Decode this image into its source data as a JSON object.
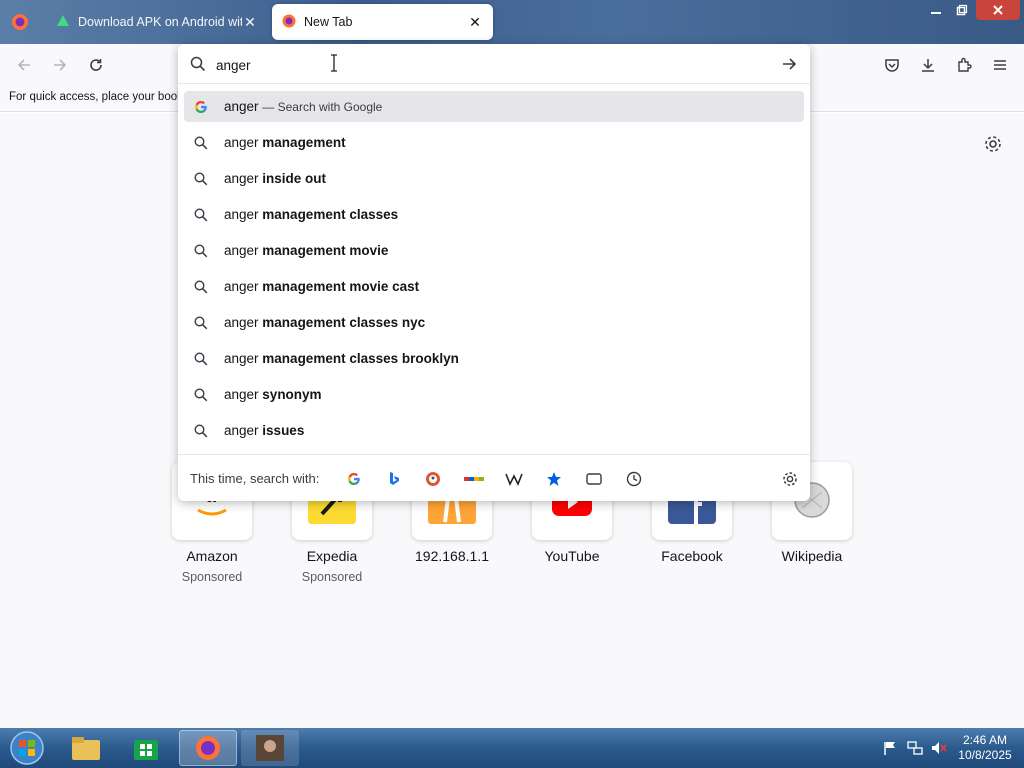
{
  "browser": {
    "tabs": [
      {
        "title": "Download APK on Android with Fre",
        "active": false
      },
      {
        "title": "New Tab",
        "active": true
      }
    ],
    "urlbar": {
      "value": "anger"
    },
    "bookmarks_hint": "For quick access, place your bookm"
  },
  "suggestions": [
    {
      "prefix": "anger",
      "suffix": "",
      "sub": "— Search with Google",
      "icon": "google-icon"
    },
    {
      "prefix": "anger",
      "suffix": "management",
      "icon": "search-icon"
    },
    {
      "prefix": "anger",
      "suffix": "inside out",
      "icon": "search-icon"
    },
    {
      "prefix": "anger",
      "suffix": "management classes",
      "icon": "search-icon"
    },
    {
      "prefix": "anger",
      "suffix": "management movie",
      "icon": "search-icon"
    },
    {
      "prefix": "anger",
      "suffix": "management movie cast",
      "icon": "search-icon"
    },
    {
      "prefix": "anger",
      "suffix": "management classes nyc",
      "icon": "search-icon"
    },
    {
      "prefix": "anger",
      "suffix": "management classes brooklyn",
      "icon": "search-icon"
    },
    {
      "prefix": "anger",
      "suffix": "synonym",
      "icon": "search-icon"
    },
    {
      "prefix": "anger",
      "suffix": "issues",
      "icon": "search-icon"
    }
  ],
  "engines": {
    "label": "This time, search with:",
    "items": [
      "Google",
      "Bing",
      "DuckDuckGo",
      "eBay",
      "Wikipedia",
      "Bookmarks",
      "Tabs",
      "History"
    ]
  },
  "shortcuts": [
    {
      "label": "Amazon",
      "sponsored": "Sponsored"
    },
    {
      "label": "Expedia",
      "sponsored": "Sponsored"
    },
    {
      "label": "192.168.1.1",
      "sponsored": ""
    },
    {
      "label": "YouTube",
      "sponsored": ""
    },
    {
      "label": "Facebook",
      "sponsored": ""
    },
    {
      "label": "Wikipedia",
      "sponsored": ""
    }
  ],
  "taskbar": {
    "time": "2:46 AM",
    "date": "10/8/2025"
  },
  "colors": {
    "accent": "#0061e0",
    "google_blue": "#4285f4",
    "youtube_red": "#ff0000",
    "facebook_blue": "#1877f2"
  }
}
